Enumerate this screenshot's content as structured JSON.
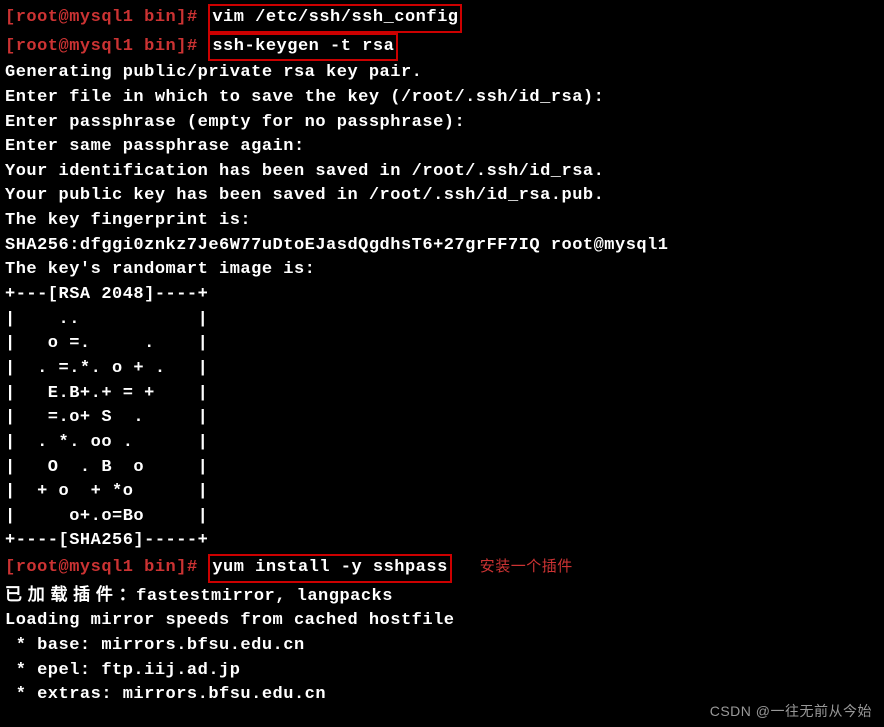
{
  "prompts": [
    {
      "user": "root@mysql1",
      "path": "bin"
    }
  ],
  "commands": {
    "cmd1": "vim /etc/ssh/ssh_config",
    "cmd2": "ssh-keygen -t rsa",
    "cmd3": "yum install -y sshpass"
  },
  "output": {
    "line1": "Generating public/private rsa key pair.",
    "line2": "Enter file in which to save the key (/root/.ssh/id_rsa):",
    "line3": "Enter passphrase (empty for no passphrase):",
    "line4": "Enter same passphrase again:",
    "line5": "Your identification has been saved in /root/.ssh/id_rsa.",
    "line6": "Your public key has been saved in /root/.ssh/id_rsa.pub.",
    "line7": "The key fingerprint is:",
    "line8": "SHA256:dfggi0znkz7Je6W77uDtoEJasdQgdhsT6+27grFF7IQ root@mysql1",
    "line9": "The key's randomart image is:",
    "art1": "+---[RSA 2048]----+",
    "art2": "|    ..           |",
    "art3": "|   o =.     .    |",
    "art4": "|  . =.*. o + .   |",
    "art5": "|   E.B+.+ = +    |",
    "art6": "|   =.o+ S  .     |",
    "art7": "|  . *. oo .      |",
    "art8": "|   O  . B  o     |",
    "art9": "|  + o  + *o      |",
    "art10": "|     o+.o=Bo     |",
    "art11": "+----[SHA256]-----+",
    "yum1_prefix": "已 加 载 插 件 ：",
    "yum1_suffix": "fastestmirror, langpacks",
    "yum2": "Loading mirror speeds from cached hostfile",
    "yum3": " * base: mirrors.bfsu.edu.cn",
    "yum4": " * epel: ftp.iij.ad.jp",
    "yum5": " * extras: mirrors.bfsu.edu.cn"
  },
  "annotation": "安装一个插件",
  "watermark": "CSDN @一往无前从今始",
  "prompt_parts": {
    "open": "[",
    "user_host": "root@mysql1",
    "space": " ",
    "path": "bin",
    "close": "]",
    "hash": "#"
  }
}
